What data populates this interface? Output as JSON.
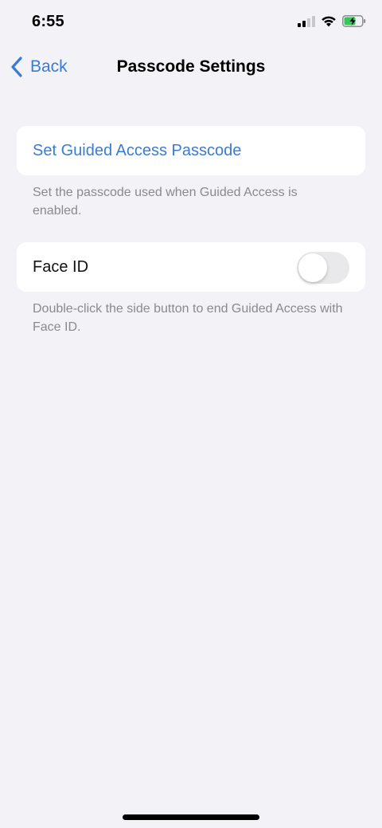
{
  "status_bar": {
    "time": "6:55",
    "battery_color": "#34c759"
  },
  "nav": {
    "back_label": "Back",
    "title": "Passcode Settings"
  },
  "passcode_group": {
    "link_label": "Set Guided Access Passcode",
    "footnote": "Set the passcode used when Guided Access is enabled."
  },
  "faceid_group": {
    "label": "Face ID",
    "toggle_on": false,
    "footnote": "Double-click the side button to end Guided Access with Face ID."
  },
  "colors": {
    "accent": "#3a7bd5",
    "background": "#f2f2f7",
    "secondary_text": "#8a8a8e"
  }
}
